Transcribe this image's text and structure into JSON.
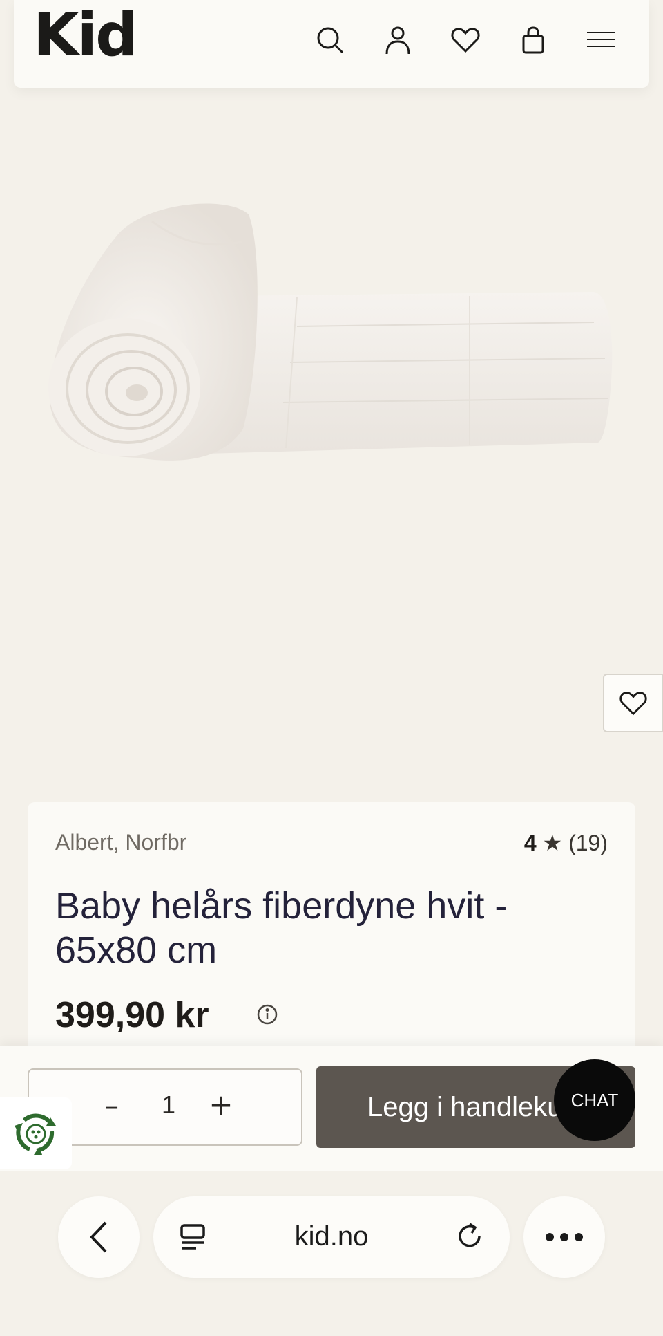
{
  "header": {
    "logo": "Kid",
    "icons": [
      "search-icon",
      "account-icon",
      "wishlist-icon",
      "cart-icon",
      "menu-icon"
    ]
  },
  "product": {
    "image_alt": "white baby quilt, rolled",
    "brand": "Albert, Norfbr",
    "rating_value": "4",
    "rating_star": "★",
    "rating_count": "(19)",
    "title": "Baby helårs fiberdyne hvit - 65x80 cm",
    "price": "399,90 kr"
  },
  "buy": {
    "qty_minus": "–",
    "quantity": "1",
    "qty_plus": "+",
    "add_to_cart": "Legg i handlekurv"
  },
  "chat": {
    "label": "CHAT"
  },
  "browser": {
    "domain": "kid.no"
  },
  "colors": {
    "background": "#f4f1ea",
    "card": "#fbfaf6",
    "button": "#5c5650",
    "chat": "#0a0a0a",
    "eco": "#2e6b2e"
  }
}
